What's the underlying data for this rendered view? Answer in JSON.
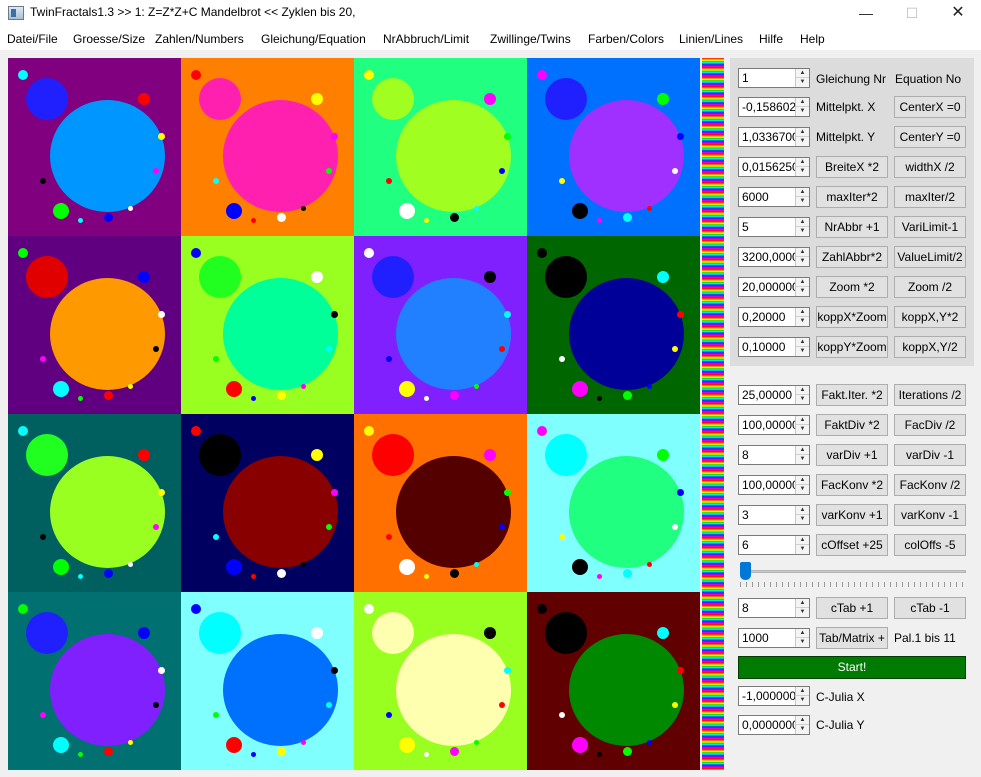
{
  "window": {
    "title": "TwinFractals1.3 >> 1: Z=Z*Z+C Mandelbrot << Zyklen bis 20,",
    "minimize": "—",
    "maximize": "☐",
    "close": "✕"
  },
  "menu": [
    "Datei/File",
    "Groesse/Size",
    "Zahlen/Numbers",
    "Gleichung/Equation",
    "NrAbbruch/Limit",
    "Zwillinge/Twins",
    "Farben/Colors",
    "Linien/Lines",
    "Hilfe",
    "Help"
  ],
  "fractal_tiles": [
    {
      "bg": "#800080",
      "fill": "#0096ff",
      "bud": "#2020ff"
    },
    {
      "bg": "#ff8000",
      "fill": "#ff20b0",
      "bud": "#ff20b0"
    },
    {
      "bg": "#20ff80",
      "fill": "#a0ff20",
      "bud": "#a0ff20"
    },
    {
      "bg": "#0070ff",
      "fill": "#a030ff",
      "bud": "#2020ff"
    },
    {
      "bg": "#600080",
      "fill": "#ff9900",
      "bud": "#e00000"
    },
    {
      "bg": "#99ff20",
      "fill": "#00ff99",
      "bud": "#20ff20"
    },
    {
      "bg": "#8020ff",
      "fill": "#2080ff",
      "bud": "#2020ff"
    },
    {
      "bg": "#006600",
      "fill": "#000099",
      "bud": "#000000"
    },
    {
      "bg": "#006060",
      "fill": "#99ff20",
      "bud": "#20ff20"
    },
    {
      "bg": "#000060",
      "fill": "#880000",
      "bud": "#000000"
    },
    {
      "bg": "#ff7000",
      "fill": "#550000",
      "bud": "#ff0000"
    },
    {
      "bg": "#80ffff",
      "fill": "#20ff80",
      "bud": "#00ffff"
    },
    {
      "bg": "#007070",
      "fill": "#8020ff",
      "bud": "#2020ff"
    },
    {
      "bg": "#80ffff",
      "fill": "#0070ff",
      "bud": "#00ffff"
    },
    {
      "bg": "#99ff20",
      "fill": "#ffffb0",
      "bud": "#ffffb0"
    },
    {
      "bg": "#600000",
      "fill": "#008800",
      "bud": "#000000"
    }
  ],
  "rows": [
    {
      "value": "1",
      "label": "Gleichung Nr",
      "label2": "Equation No"
    },
    {
      "value": "-0,1586020",
      "label": "Mittelpkt. X",
      "button": "CenterX =0"
    },
    {
      "value": "1,0336700",
      "label": "Mittelpkt. Y",
      "button": "CenterY =0"
    },
    {
      "value": "0,0156250",
      "button1": "BreiteX *2",
      "button2": "widthX /2"
    },
    {
      "value": "6000",
      "button1": "maxIter*2",
      "button2": "maxIter/2"
    },
    {
      "value": "5",
      "button1": "NrAbbr +1",
      "button2": "VariLimit-1"
    },
    {
      "value": "3200,0000",
      "button1": "ZahlAbbr*2",
      "button2": "ValueLimit/2"
    },
    {
      "value": "20,000000",
      "button1": "Zoom *2",
      "button2": "Zoom /2"
    },
    {
      "value": "0,20000",
      "button1": "koppX*Zoom",
      "button2": "koppX,Y*2"
    },
    {
      "value": "0,10000",
      "button1": "koppY*Zoom",
      "button2": "koppX,Y/2"
    },
    {
      "value": "25,00000",
      "button1": "Fakt.Iter. *2",
      "button2": "Iterations /2"
    },
    {
      "value": "100,00000",
      "button1": "FaktDiv *2",
      "button2": "FacDiv /2"
    },
    {
      "value": "8",
      "button1": "varDiv +1",
      "button2": "varDiv -1"
    },
    {
      "value": "100,00000",
      "button1": "FacKonv *2",
      "button2": "FacKonv /2"
    },
    {
      "value": "3",
      "button1": "varKonv +1",
      "button2": "varKonv -1"
    },
    {
      "value": "6",
      "button1": "cOffset +25",
      "button2": "colOffs -5"
    },
    {
      "value": "8",
      "button1": "cTab +1",
      "button2": "cTab -1"
    },
    {
      "value": "1000",
      "button1": "Tab/Matrix +",
      "label": "Pal.1 bis 11"
    },
    {
      "value": "-1,0000000",
      "label": "C-Julia X"
    },
    {
      "value": "0,0000000",
      "label": "C-Julia Y"
    }
  ],
  "slider": {
    "value": 0.0
  },
  "start_label": "Start!"
}
